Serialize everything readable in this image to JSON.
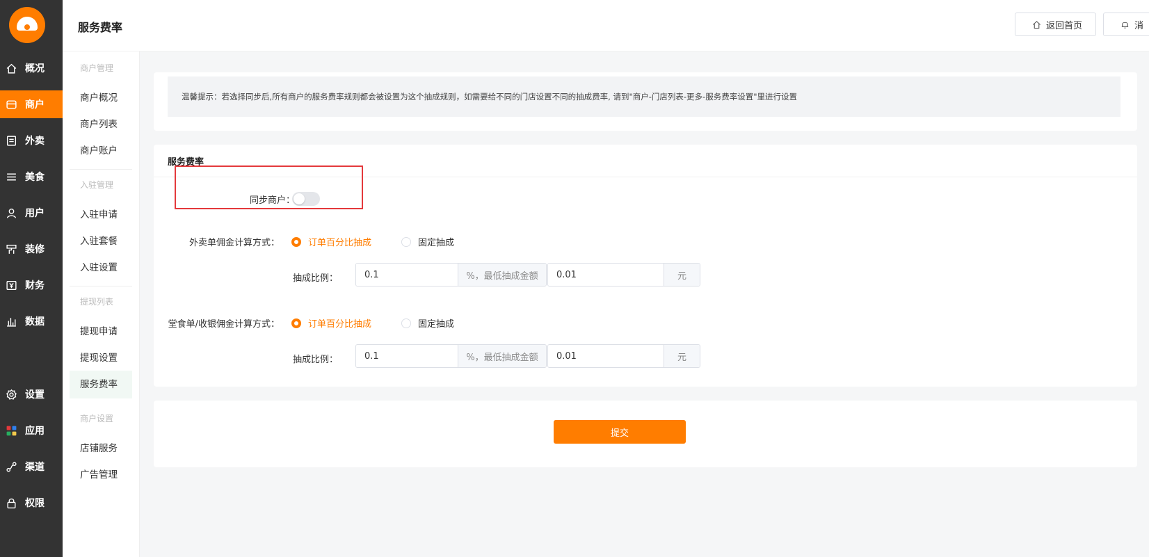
{
  "sidebar": {
    "items": [
      {
        "label": "概况",
        "icon": "home-icon"
      },
      {
        "label": "商户",
        "icon": "store-icon",
        "active": true
      },
      {
        "label": "外卖",
        "icon": "document-icon"
      },
      {
        "label": "美食",
        "icon": "menu-icon"
      },
      {
        "label": "用户",
        "icon": "user-icon"
      },
      {
        "label": "装修",
        "icon": "paint-roller-icon"
      },
      {
        "label": "财务",
        "icon": "yuan-wallet-icon"
      },
      {
        "label": "数据",
        "icon": "bar-chart-icon"
      },
      {
        "label": "设置",
        "icon": "gear-icon"
      },
      {
        "label": "应用",
        "icon": "apps-icon"
      },
      {
        "label": "渠道",
        "icon": "channel-icon"
      },
      {
        "label": "权限",
        "icon": "lock-icon"
      }
    ]
  },
  "subnav": {
    "groups": [
      {
        "heading": "商户管理",
        "items": [
          "商户概况",
          "商户列表",
          "商户账户"
        ]
      },
      {
        "heading": "入驻管理",
        "items": [
          "入驻申请",
          "入驻套餐",
          "入驻设置"
        ]
      },
      {
        "heading": "提现列表",
        "items": [
          "提现申请",
          "提现设置",
          "服务费率"
        ]
      },
      {
        "heading": "商户设置",
        "items": [
          "店铺服务",
          "广告管理"
        ]
      }
    ],
    "active": "服务费率"
  },
  "header": {
    "title": "服务费率",
    "home_button": "返回首页",
    "message_button": "消"
  },
  "tip": {
    "text": "温馨提示：若选择同步后,所有商户的服务费率规则都会被设置为这个抽成规则，如需要给不同的门店设置不同的抽成费率, 请到\"商户-门店列表-更多-服务费率设置\"里进行设置"
  },
  "form": {
    "section_title": "服务费率",
    "sync_label": "同步商户：",
    "sync_enabled": false,
    "takeaway": {
      "label": "外卖单佣金计算方式：",
      "option_percent": "订单百分比抽成",
      "option_fixed": "固定抽成",
      "selected": "percent",
      "ratio_label": "抽成比例：",
      "ratio_value": "0.1",
      "ratio_addon": "%，最低抽成金额",
      "min_value": "0.01",
      "min_addon": "元"
    },
    "dinein": {
      "label": "堂食单/收银佣金计算方式：",
      "option_percent": "订单百分比抽成",
      "option_fixed": "固定抽成",
      "selected": "percent",
      "ratio_label": "抽成比例：",
      "ratio_value": "0.1",
      "ratio_addon": "%，最低抽成金额",
      "min_value": "0.01",
      "min_addon": "元"
    },
    "submit_label": "提交"
  },
  "colors": {
    "accent": "#ff7d00",
    "sidebar_bg": "#333333",
    "highlight_box": "#e4393c"
  }
}
